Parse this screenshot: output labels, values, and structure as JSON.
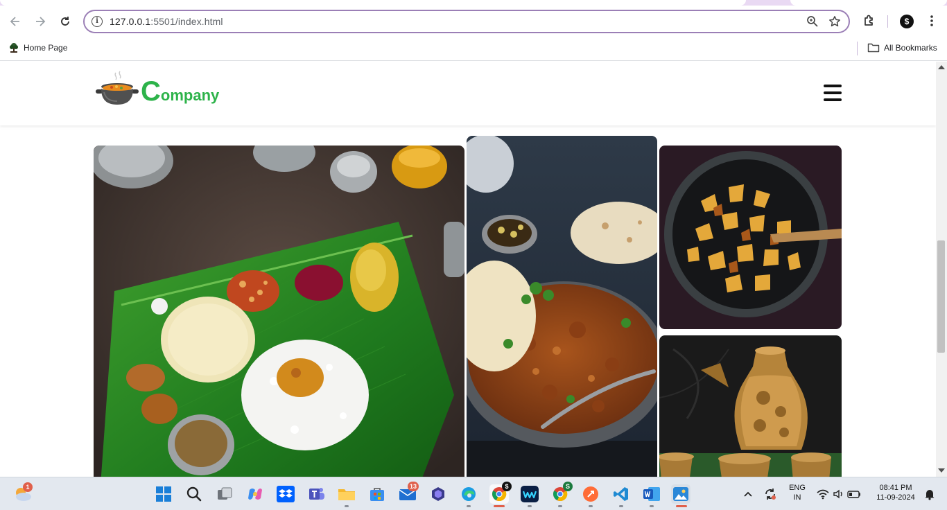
{
  "browser": {
    "url_host": "127.0.0.1",
    "url_rest": ":5501/index.html",
    "back_icon": "arrow-left-icon",
    "forward_icon": "arrow-right-icon",
    "reload_icon": "reload-icon"
  },
  "bookmarks": {
    "home_label": "Home Page",
    "all_label": "All Bookmarks"
  },
  "site": {
    "logo_first_letter": "C",
    "logo_rest": "ompany",
    "brand_color": "#2db34a"
  },
  "gallery": {
    "images": [
      "banana-leaf-thali-photo",
      "mutton-curry-naan-photo",
      "fried-potatoes-pan-photo",
      "brass-jug-cups-photo"
    ]
  },
  "taskbar": {
    "weather_badge": "1",
    "mail_badge": "13",
    "chrome_badge": "$",
    "chrome2_badge": "S",
    "language": "ENG",
    "region": "IN",
    "time": "08:41 PM",
    "date": "11-09-2024"
  }
}
